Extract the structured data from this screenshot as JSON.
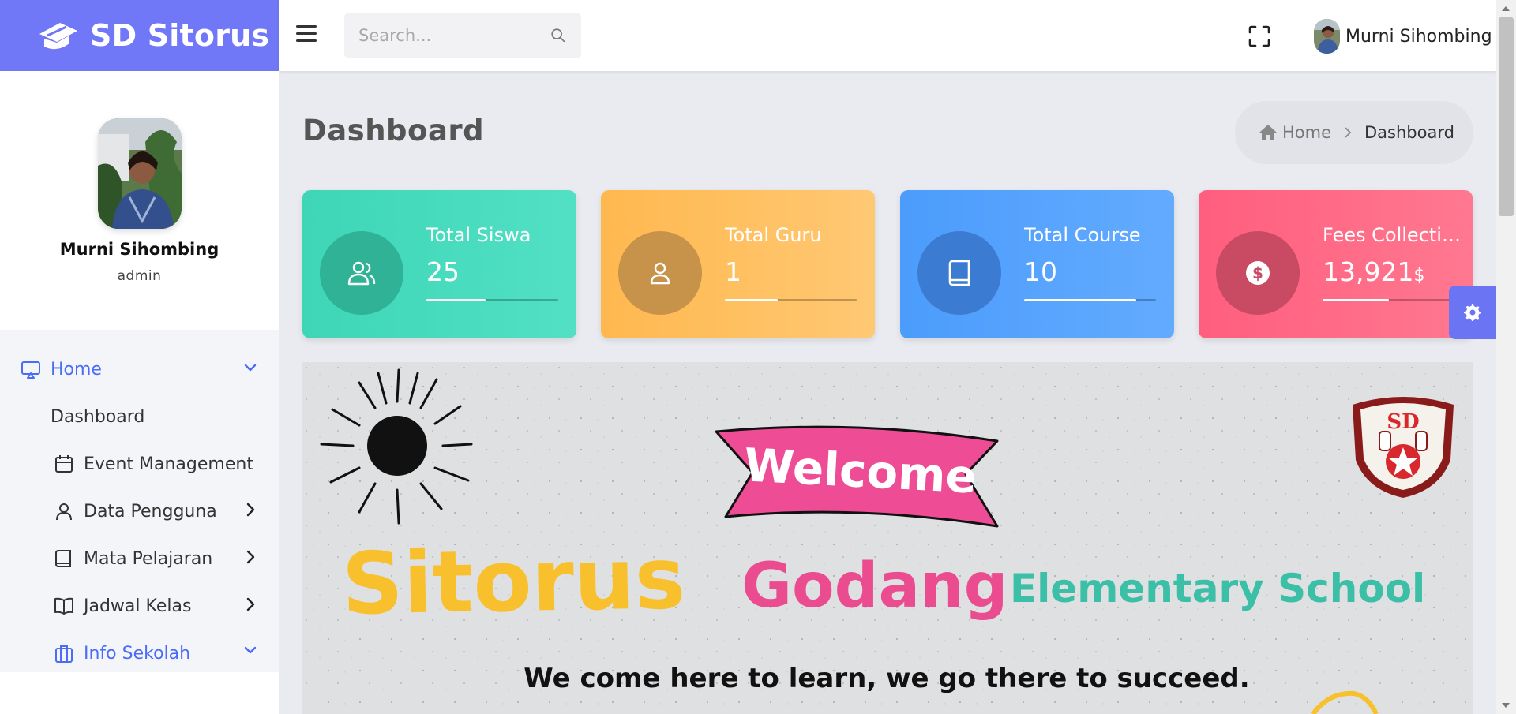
{
  "brand": {
    "name": "SD Sitorus"
  },
  "header": {
    "search_placeholder": "Search...",
    "user_name": "Murni Sihombing"
  },
  "profile": {
    "name": "Murni Sihombing",
    "role": "admin"
  },
  "menu": {
    "home": "Home",
    "dashboard": "Dashboard",
    "event": "Event Management",
    "pengguna": "Data Pengguna",
    "pelajaran": "Mata Pelajaran",
    "jadwal": "Jadwal Kelas",
    "info": "Info Sekolah"
  },
  "page": {
    "title": "Dashboard"
  },
  "breadcrumb": {
    "home": "Home",
    "current": "Dashboard"
  },
  "stats": [
    {
      "label": "Total Siswa",
      "value": "25",
      "unit": "",
      "progress": 0.45,
      "color": "#3dd6b6"
    },
    {
      "label": "Total Guru",
      "value": "1",
      "unit": "",
      "progress": 0.4,
      "color": "#ffb84f"
    },
    {
      "label": "Total Course",
      "value": "10",
      "unit": "",
      "progress": 0.85,
      "color": "#4b9cfc"
    },
    {
      "label": "Fees Collection",
      "value": "13,921",
      "unit": "$",
      "progress": 0.5,
      "color": "#ff5e7e"
    }
  ],
  "banner": {
    "welcome": "Welcome",
    "word1": "Sitorus",
    "word2": "Godang",
    "word3": "Elementary School",
    "tagline": "We come here to learn, we go there to succeed.",
    "logo_text": "SD"
  },
  "colors": {
    "brand": "#7078f8",
    "accent": "#4a6cf7"
  }
}
